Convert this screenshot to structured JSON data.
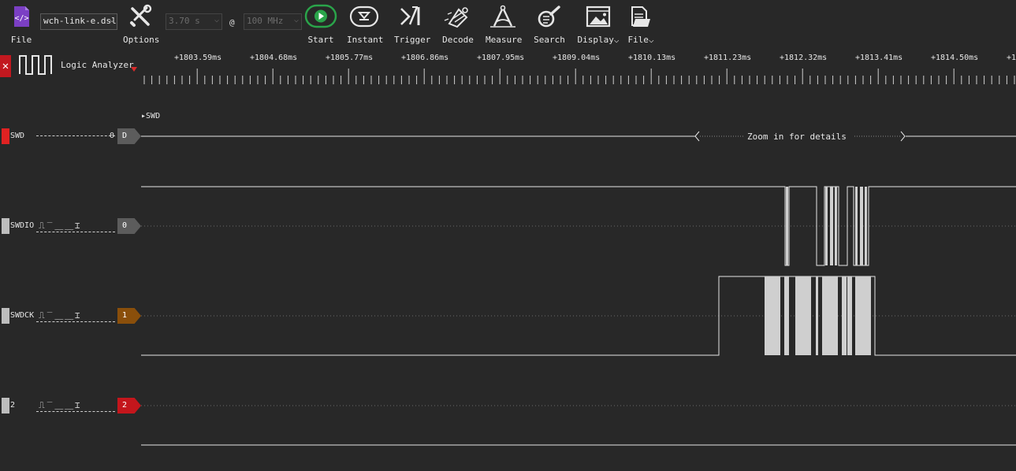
{
  "toolbar": {
    "file_label": "File",
    "device_select": "wch-link-e.dsl",
    "options_label": "Options",
    "duration_select": "3.70 s",
    "at_symbol": "@",
    "rate_select": "100 MHz",
    "start_label": "Start",
    "instant_label": "Instant",
    "trigger_label": "Trigger",
    "decode_label": "Decode",
    "measure_label": "Measure",
    "search_label": "Search",
    "display_label": "Display",
    "file_menu_label": "File"
  },
  "header": {
    "mode_label": "Logic Analyzer",
    "close_glyph": "✕"
  },
  "ruler": {
    "labels": [
      "+1803.59ms",
      "+1804.68ms",
      "+1805.77ms",
      "+1806.86ms",
      "+1807.95ms",
      "+1809.04ms",
      "+1810.13ms",
      "+1811.23ms",
      "+1812.32ms",
      "+1813.41ms",
      "+1814.50ms",
      "+1"
    ]
  },
  "decoder": {
    "name": "SWD",
    "value": "0",
    "badge": "D",
    "subrow_label": "SWD",
    "zoom_message": "Zoom in for details"
  },
  "channels": [
    {
      "name": "SWDIO",
      "badge": "0",
      "badge_color": "#5c5c5c",
      "triggers": "⎍‾⎽⎽⌶"
    },
    {
      "name": "SWDCK",
      "badge": "1",
      "badge_color": "#8a4f0b",
      "triggers": "⎍‾⎽⎽⌶"
    },
    {
      "name": "2",
      "badge": "2",
      "badge_color": "#c4161c",
      "triggers": "⎍‾⎽⎽⌶"
    }
  ],
  "colors": {
    "background": "#282828",
    "decoder_swatch": "#e02222",
    "channel_swatch": "#bdbdbd",
    "start_button": "#2aa44a",
    "file_icon": "#7b3fc4",
    "signal": "#e6e6e6",
    "burst_fill": "#cfcfcf"
  }
}
